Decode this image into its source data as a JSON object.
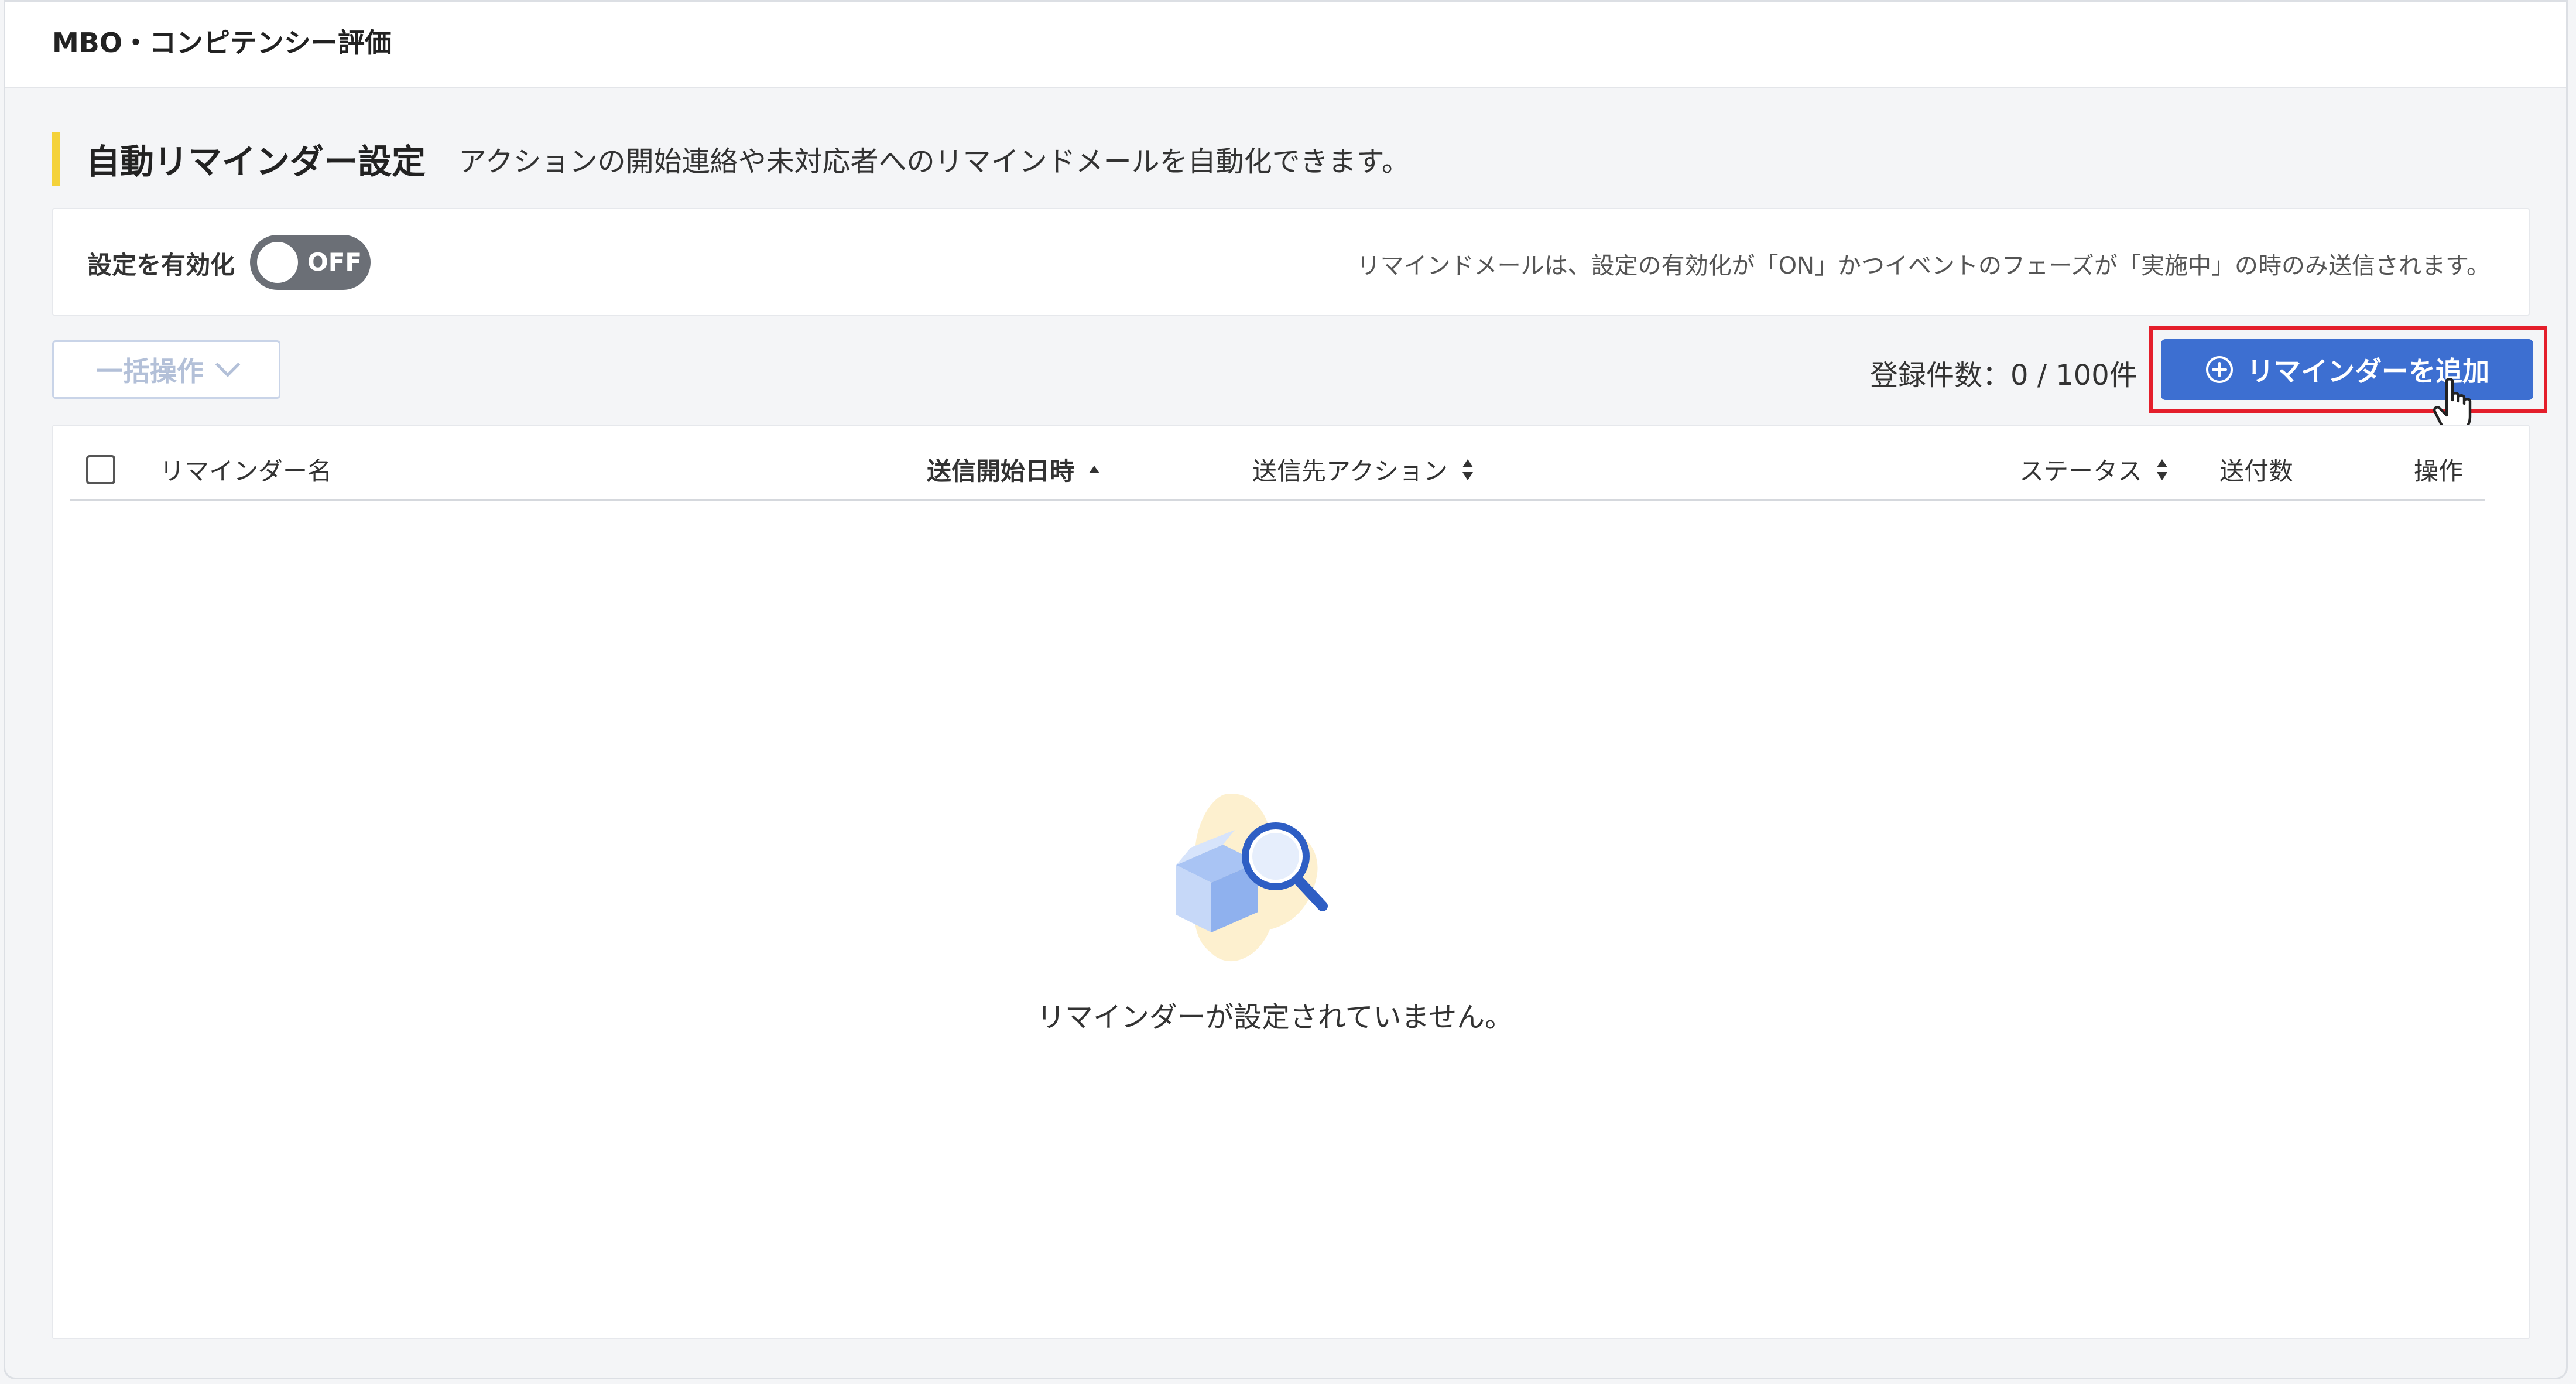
{
  "app": {
    "title": "MBO・コンピテンシー評価"
  },
  "section": {
    "title": "自動リマインダー設定",
    "description": "アクションの開始連絡や未対応者へのリマインドメールを自動化できます。"
  },
  "settings": {
    "enable_label": "設定を有効化",
    "toggle_state": "OFF",
    "note": "リマインドメールは、設定の有効化が「ON」かつイベントのフェーズが「実施中」の時のみ送信されます。"
  },
  "toolbar": {
    "bulk_label": "一括操作",
    "count_text": "登録件数：0 / 100件",
    "add_label": "リマインダーを追加"
  },
  "table": {
    "columns": {
      "name": "リマインダー名",
      "start": "送信開始日時",
      "action": "送信先アクション",
      "status": "ステータス",
      "sent": "送付数",
      "ops": "操作"
    },
    "empty_message": "リマインダーが設定されていません。"
  },
  "colors": {
    "accent": "#3d6fd1",
    "section_bar": "#f4d23a",
    "highlight": "#e41e2b",
    "toggle_off": "#6b6f76"
  },
  "icons": {
    "add": "plus-circle-icon",
    "cursor": "hand-pointer-icon",
    "bulk": "chevron-down-icon",
    "empty": "box-search-icon"
  }
}
